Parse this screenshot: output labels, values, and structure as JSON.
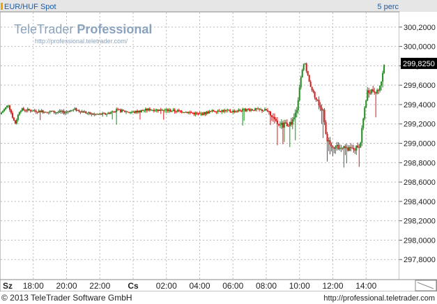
{
  "header": {
    "instrument": "EUR/HUF Spot",
    "interval": "5 perc"
  },
  "watermark": {
    "brand_regular": "TeleTrader",
    "brand_bold": "Professional",
    "url": "http://professional.teletrader.com/"
  },
  "footer": {
    "copyright": "© 2013 TeleTrader Software GmbH",
    "url": "http://professional.teletrader.com"
  },
  "colors": {
    "up": "#1a8f1a",
    "down": "#e01414",
    "grid": "#b9b9b9",
    "current_badge_bg": "#000000",
    "current_badge_text": "#ffffff",
    "header_bg": "#e4e4e4",
    "accent_marker": "#f0a400"
  },
  "chart_data": {
    "type": "candlestick",
    "instrument": "EUR/HUF Spot",
    "interval": "5 perc",
    "current_value": "299,8250",
    "ylim": [
      297.6,
      300.35
    ],
    "y_ticks": [
      "300,2000",
      "300,0000",
      "299,8000",
      "299,6000",
      "299,4000",
      "299,2000",
      "299,0000",
      "298,8000",
      "298,6000",
      "298,4000",
      "298,2000",
      "298,0000",
      "297,8000"
    ],
    "y_tick_values": [
      300.2,
      300.0,
      299.8,
      299.6,
      299.4,
      299.2,
      299.0,
      298.8,
      298.6,
      298.4,
      298.2,
      298.0,
      297.8
    ],
    "x_ticks": [
      "Sz",
      "18:00",
      "20:00",
      "22:00",
      "Cs",
      "02:00",
      "04:00",
      "06:00",
      "08:00",
      "10:00",
      "12:00",
      "14:00"
    ],
    "x_tick_hours": [
      16,
      18,
      20,
      22,
      24,
      26,
      28,
      30,
      32,
      34,
      36,
      38
    ],
    "x_range_hours": [
      16,
      40
    ],
    "grid": true,
    "price_path": [
      [
        16.0,
        299.3
      ],
      [
        16.5,
        299.4
      ],
      [
        16.9,
        299.2
      ],
      [
        17.2,
        299.35
      ],
      [
        18.5,
        299.33
      ],
      [
        19.8,
        299.32
      ],
      [
        20.5,
        299.35
      ],
      [
        21.5,
        299.3
      ],
      [
        22.3,
        299.3
      ],
      [
        23.0,
        299.34
      ],
      [
        24.0,
        299.32
      ],
      [
        25.0,
        299.35
      ],
      [
        26.0,
        299.34
      ],
      [
        27.0,
        299.33
      ],
      [
        28.0,
        299.3
      ],
      [
        29.0,
        299.34
      ],
      [
        30.0,
        299.33
      ],
      [
        31.0,
        299.35
      ],
      [
        32.0,
        299.34
      ],
      [
        32.5,
        299.22
      ],
      [
        33.0,
        299.18
      ],
      [
        33.6,
        299.22
      ],
      [
        33.9,
        299.4
      ],
      [
        34.1,
        299.7
      ],
      [
        34.3,
        299.85
      ],
      [
        34.6,
        299.62
      ],
      [
        35.0,
        299.45
      ],
      [
        35.4,
        299.35
      ],
      [
        35.6,
        299.05
      ],
      [
        36.0,
        298.98
      ],
      [
        36.5,
        298.95
      ],
      [
        37.0,
        298.93
      ],
      [
        37.5,
        298.95
      ],
      [
        37.7,
        299.05
      ],
      [
        37.9,
        299.35
      ],
      [
        38.1,
        299.55
      ],
      [
        38.5,
        299.55
      ],
      [
        38.8,
        299.55
      ],
      [
        39.1,
        299.85
      ]
    ]
  }
}
